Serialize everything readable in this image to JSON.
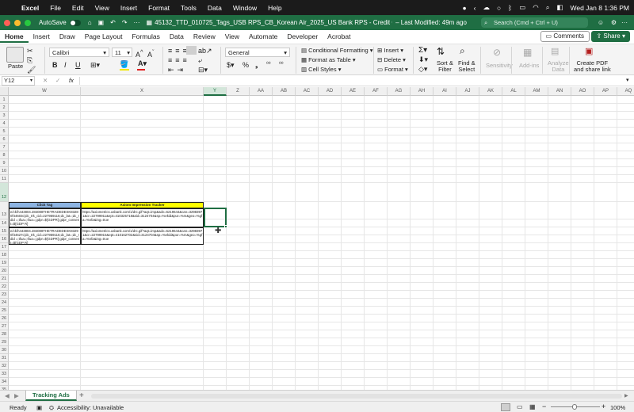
{
  "menubar": {
    "app": "Excel",
    "items": [
      "File",
      "Edit",
      "View",
      "Insert",
      "Format",
      "Tools",
      "Data",
      "Window",
      "Help"
    ],
    "clock": "Wed Jan 8  1:36 PM"
  },
  "titlebar": {
    "autosave": "AutoSave",
    "filename": "45132_TTD_010725_Tags_USB RPS_CB_Korean Air_2025_US Bank RPS - Credit Card_IASModifi...",
    "modified": "– Last Modified: 49m ago",
    "search_placeholder": "Search (Cmd + Ctrl + U)"
  },
  "tabs": [
    "Home",
    "Insert",
    "Draw",
    "Page Layout",
    "Formulas",
    "Data",
    "Review",
    "View",
    "Automate",
    "Developer",
    "Acrobat"
  ],
  "buttons": {
    "comments": "Comments",
    "share": "Share"
  },
  "ribbon": {
    "paste": "Paste",
    "font": "Calibri",
    "size": "11",
    "number_format": "General",
    "conditional": "Conditional Formatting",
    "as_table": "Format as Table",
    "cell_styles": "Cell Styles",
    "insert": "Insert",
    "delete": "Delete",
    "format": "Format",
    "sort1": "Sort &",
    "sort2": "Filter",
    "find1": "Find &",
    "find2": "Select",
    "sensitivity": "Sensitivity",
    "addins": "Add-ins",
    "analyze1": "Analyze",
    "analyze2": "Data",
    "pdf1": "Create PDF",
    "pdf2": "and share link"
  },
  "formula_bar": {
    "name_box": "Y12",
    "fx": "fx"
  },
  "columns": [
    "W",
    "X",
    "Y",
    "Z",
    "AA",
    "AB",
    "AC",
    "AD",
    "AE",
    "AF",
    "AG",
    "AH",
    "AI",
    "AJ",
    "AK",
    "AL",
    "AM",
    "AN",
    "AO",
    "AP",
    "AQ"
  ],
  "rows": [
    "1",
    "2",
    "3",
    "4",
    "5",
    "6",
    "7",
    "8",
    "9",
    "10",
    "11",
    "12",
    "13",
    "14",
    "15",
    "16",
    "17",
    "18",
    "19",
    "20",
    "21",
    "22",
    "23",
    "24",
    "25",
    "26",
    "27",
    "28",
    "29",
    "30",
    "31",
    "32",
    "33",
    "34",
    "35",
    "36",
    "37"
  ],
  "table": {
    "header_w": "Click Tag",
    "header_x": "Axiom Impression Tracker",
    "row12_w": "e/ck/h443804.284088THETRADEDESK8328 0f44603c(dc_trk_cid=227959116;dc_lat=;dc_rdid =;tfua=;tfua=;gdpr=${GDPR};gdpr_consent=${GDP R}",
    "row12_x": "https://axiometrics.usbank.com/1/drc.gif?aqt=imp&adv=6219644&can=32983971&cr=22799911&ept=410325718&sid=3124704&sp=%ekid&pur=%m&geo=%gfa=%nfa&ing=true",
    "row13_w": "e/ck/h443804.284088THETRADEDESK8329 0f44627c(dc_trk_cid=227959116;dc_lat=;dc_rdid =;tfua=;tfua=;gdpr=${GDPR};gdpr_consent=${GDP R}",
    "row13_x": "https://axiometrics.usbank.com/1/drc.gif?aqt=imp&adv=6219644&can=32983971&cr=22799915&ept=410162702&sid=3124704&sp=%ekid&pur=%m&geo=%gfa=%nfa&ing=true"
  },
  "sheet_tab": "Tracking Ads",
  "status": {
    "ready": "Ready",
    "accessibility": "Accessibility: Unavailable",
    "zoom": "100%"
  }
}
